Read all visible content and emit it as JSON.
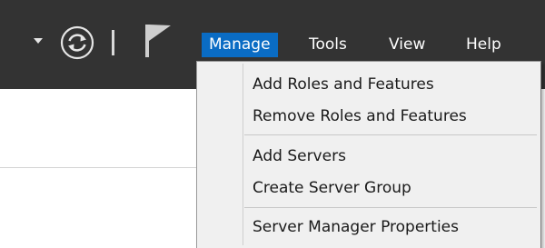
{
  "toolbar": {
    "icons": [
      "chevron-down-icon",
      "refresh-icon",
      "separator",
      "flag-icon"
    ]
  },
  "menubar": {
    "items": [
      {
        "label": "Manage",
        "active": true
      },
      {
        "label": "Tools"
      },
      {
        "label": "View"
      },
      {
        "label": "Help"
      }
    ],
    "active_color": "#0a6cc4",
    "bar_color": "#333333"
  },
  "manage_menu": {
    "groups": [
      [
        "Add Roles and Features",
        "Remove Roles and Features"
      ],
      [
        "Add Servers",
        "Create Server Group"
      ],
      [
        "Server Manager Properties"
      ]
    ],
    "items": [
      "Add Roles and Features",
      "Remove Roles and Features",
      "Add Servers",
      "Create Server Group",
      "Server Manager Properties"
    ]
  }
}
